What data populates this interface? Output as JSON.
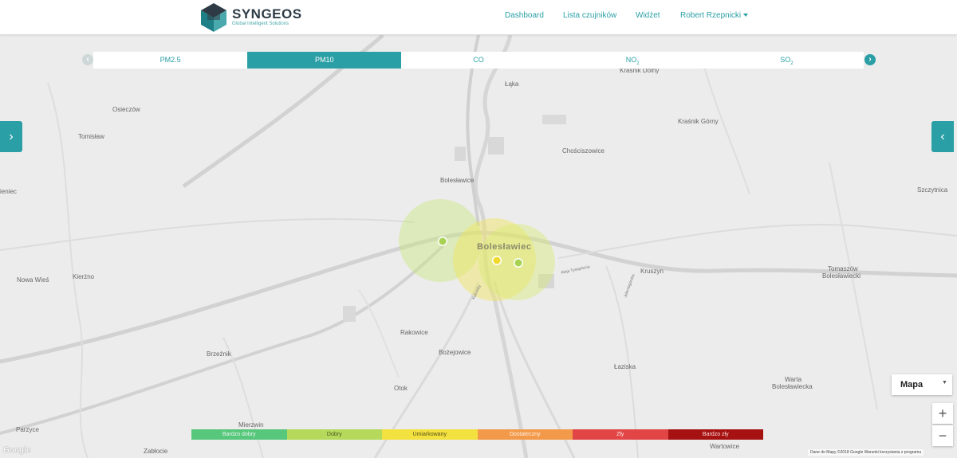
{
  "header": {
    "brand": "SYNGEOS",
    "tagline": "Global Intelligent Solutions",
    "nav": {
      "dashboard": "Dashboard",
      "sensors": "Lista czujników",
      "widget": "Widżet",
      "user": "Robert Rzepnicki"
    }
  },
  "pollutant_tabs": [
    {
      "label": "PM2.5",
      "sub": "",
      "active": false
    },
    {
      "label": "PM10",
      "sub": "",
      "active": true
    },
    {
      "label": "CO",
      "sub": "",
      "active": false
    },
    {
      "label": "NO",
      "sub": "2",
      "active": false
    },
    {
      "label": "SO",
      "sub": "2",
      "active": false
    }
  ],
  "map": {
    "type_label": "Mapa",
    "zoom_in": "+",
    "zoom_out": "−",
    "google": "Google",
    "attribution": "Dane do Mapy ©2018 Google    Warunki korzystania z programu",
    "places": {
      "osieczow": "Osieczów",
      "tomislaw": "Tomisław",
      "lake": "Łąka",
      "krasnik_dolny": "Kraśnik Dolny",
      "krasnik_gorny": "Kraśnik Górny",
      "choscizowice": "Chościszowice",
      "boleslawice": "Bolesławice",
      "szczytnica": "Szczytnica",
      "dzieniec": "ieniec",
      "boleslawiec": "Bolesławiec",
      "kruszyn": "Kruszyn",
      "tomaszow": "Tomaszów",
      "tomaszow2": "Bolesławiecki",
      "nowa_wies": "Nowa Wieś",
      "kierzno": "Kierżno",
      "rakowice": "Rakowice",
      "brzeznik": "Brzeźnik",
      "bozejowice": "Bożejowice",
      "laziska": "Łaziska",
      "otok": "Otok",
      "warta": "Warta",
      "warta2": "Bolesławiecka",
      "parzyce": "Parzyce",
      "mierzwin": "Mierzwin",
      "zablocie": "Zabłocie",
      "wartowice": "Wartowice"
    },
    "road_labels": {
      "tyrnalskie": "Aleja Tysiąclecia",
      "kosciuszki": "Jeleniogórska",
      "kutrzeby": "Kutrzeby"
    }
  },
  "legend": [
    {
      "label": "Bardzo dobry",
      "color": "#57c77c"
    },
    {
      "label": "Dobry",
      "color": "#b5d95a"
    },
    {
      "label": "Umiarkowany",
      "color": "#f2e13f"
    },
    {
      "label": "Dostateczny",
      "color": "#f39a4a"
    },
    {
      "label": "Zły",
      "color": "#e24545"
    },
    {
      "label": "Bardzo zły",
      "color": "#a61212"
    }
  ],
  "colors": {
    "accent": "#2a9fa5"
  },
  "icons": {
    "side_left": "chevron-right-icon",
    "side_right": "chevron-left-icon",
    "tabs_prev": "chevron-left-icon",
    "tabs_next": "chevron-right-icon"
  }
}
